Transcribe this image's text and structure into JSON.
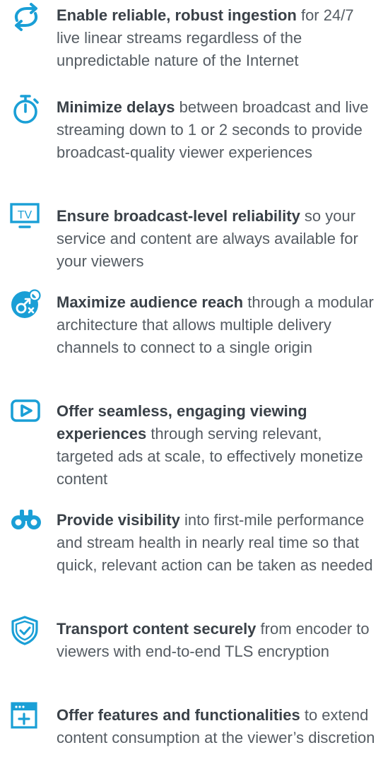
{
  "accent_color": "#1a9fd6",
  "items": [
    {
      "icon": "sync-arrows-icon",
      "lead": "Enable reliable, robust ingestion",
      "rest": " for 24/7 live linear streams regardless of the unpredictable nature of the Internet"
    },
    {
      "icon": "stopwatch-icon",
      "lead": "Minimize delays",
      "rest": " between broadcast and live streaming down to 1 or 2 seconds to provide broadcast-quality viewer experiences"
    },
    {
      "icon": "tv-icon",
      "icon_label": "TV",
      "lead": "Ensure broadcast-level reliability",
      "rest": " so your service and content are always available for your viewers"
    },
    {
      "icon": "audience-gender-icon",
      "lead": "Maximize audience reach",
      "rest": " through a modular architecture that allows multiple delivery channels to connect to a single origin"
    },
    {
      "icon": "play-button-icon",
      "lead": "Offer seamless, engaging viewing experiences",
      "rest": " through serving relevant, targeted ads at scale, to effectively monetize content"
    },
    {
      "icon": "binoculars-icon",
      "lead": "Provide visibility",
      "rest": " into first-mile performance and stream health in nearly real time so that quick, relevant action can be taken as needed"
    },
    {
      "icon": "shield-check-icon",
      "lead": "Transport content securely",
      "rest": " from encoder to viewers with end-to-end TLS encryption"
    },
    {
      "icon": "add-window-icon",
      "lead": "Offer features and functionalities",
      "rest": " to extend content consumption at the viewer’s discretion"
    }
  ]
}
